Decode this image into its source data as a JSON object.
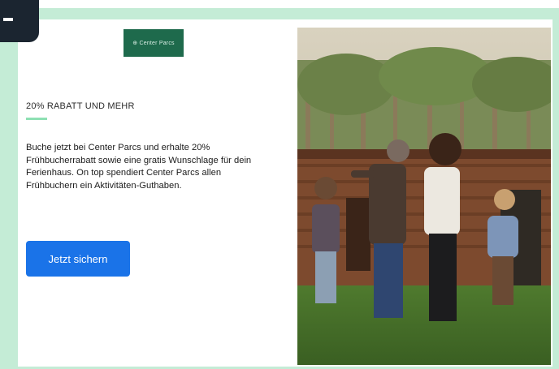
{
  "ad": {
    "brand_logo_text": "⊕ Center Parcs",
    "eyebrow": "20% RABATT UND MEHR",
    "body": "Buche jetzt bei Center Parcs und erhalte 20% Frühbucherrabatt sowie eine gratis Wunschlage für dein Ferienhaus. On top spendiert Center Parcs allen Frühbuchern ein Aktivitäten-Guthaben.",
    "cta_label": "Jetzt sichern"
  },
  "icons": {
    "corner_tab": "tab-marker-icon"
  },
  "colors": {
    "page_bg": "#c4ecd6",
    "brand_green": "#1e6a4c",
    "accent_mint": "#8ee0b3",
    "cta_blue": "#1a73e8",
    "corner_tab": "#1b2530"
  }
}
